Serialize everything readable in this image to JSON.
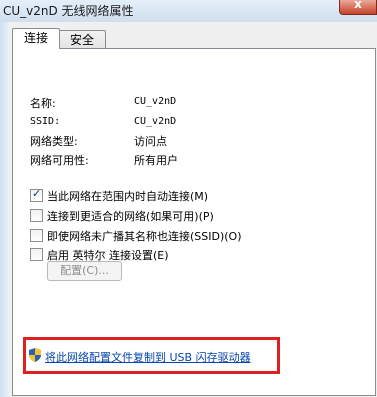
{
  "window": {
    "title": "CU_v2nD 无线网络属性",
    "close_glyph": "x"
  },
  "tabs": [
    {
      "label": "连接",
      "selected": true
    },
    {
      "label": "安全",
      "selected": false
    }
  ],
  "info": {
    "name_label": "名称:",
    "name_value": "CU_v2nD",
    "ssid_label": "SSID:",
    "ssid_value": "CU_v2nD",
    "type_label": "网络类型:",
    "type_value": "访问点",
    "availability_label": "网络可用性:",
    "availability_value": "所有用户"
  },
  "options": [
    {
      "label": "当此网络在范围内时自动连接(M)",
      "checked": true
    },
    {
      "label": "连接到更适合的网络(如果可用)(P)",
      "checked": false
    },
    {
      "label": "即使网络未广播其名称也连接(SSID)(O)",
      "checked": false
    },
    {
      "label": "启用 英特尔 连接设置(E)",
      "checked": false
    }
  ],
  "config_button": "配置(C)...",
  "copy_link": "将此网络配置文件复制到 USB 闪存驱动器",
  "colors": {
    "highlight": "#e02020",
    "link": "#0645ad"
  },
  "icons": {
    "shield": "uac-shield-icon",
    "check": "checkmark-icon"
  }
}
